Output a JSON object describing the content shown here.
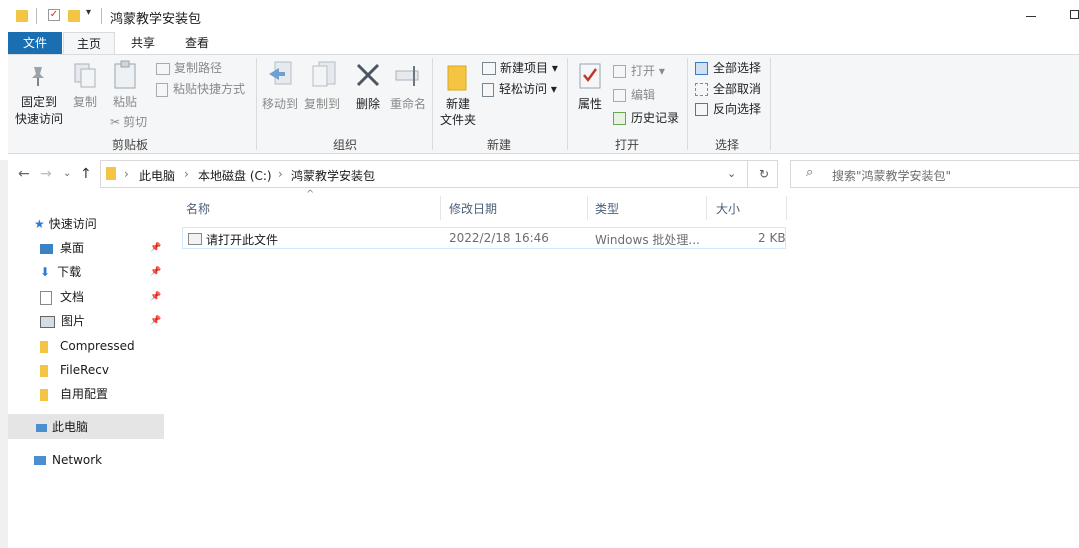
{
  "window": {
    "title": "鸿蒙教学安装包"
  },
  "menu_tabs": [
    "文件",
    "主页",
    "共享",
    "查看"
  ],
  "ribbon": {
    "clipboard": {
      "pin_label_1": "固定到",
      "pin_label_2": "快速访问",
      "copy": "复制",
      "paste": "粘贴",
      "copy_path": "复制路径",
      "paste_shortcut": "粘贴快捷方式",
      "cut": "剪切",
      "group": "剪贴板"
    },
    "organize": {
      "move_to": "移动到",
      "copy_to": "复制到",
      "delete": "删除",
      "rename": "重命名",
      "group": "组织"
    },
    "new": {
      "new_folder_1": "新建",
      "new_folder_2": "文件夹",
      "new_item": "新建项目 ▾",
      "easy_access": "轻松访问 ▾",
      "group": "新建"
    },
    "open": {
      "properties": "属性",
      "open": "打开 ▾",
      "edit": "编辑",
      "history": "历史记录",
      "group": "打开"
    },
    "select": {
      "select_all": "全部选择",
      "select_none": "全部取消",
      "invert": "反向选择",
      "group": "选择"
    }
  },
  "address": {
    "crumbs": [
      "此电脑",
      "本地磁盘 (C:)",
      "鸿蒙教学安装包"
    ]
  },
  "search": {
    "placeholder": "搜索\"鸿蒙教学安装包\""
  },
  "nav_pane": {
    "quick_access": "快速访问",
    "items": [
      "桌面",
      "下载",
      "文档",
      "图片",
      "Compressed",
      "FileRecv",
      "自用配置"
    ],
    "this_pc": "此电脑",
    "network": "Network"
  },
  "columns": {
    "name": "名称",
    "date": "修改日期",
    "type": "类型",
    "size": "大小"
  },
  "files": [
    {
      "name": "请打开此文件",
      "date": "2022/2/18 16:46",
      "type": "Windows 批处理...",
      "size": "2 KB"
    }
  ]
}
